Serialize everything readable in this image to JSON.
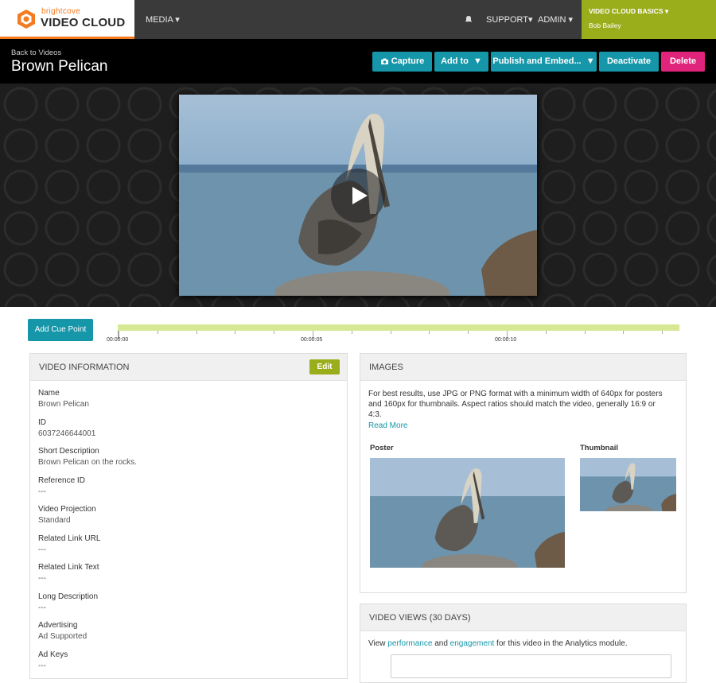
{
  "logo": {
    "small": "brightcove",
    "big": "VIDEO CLOUD"
  },
  "nav": {
    "media": "MEDIA ▾",
    "support": "SUPPORT▾",
    "admin": "ADMIN ▾"
  },
  "account": {
    "title": "VIDEO CLOUD BASICS ▾",
    "user": "Bob Bailey"
  },
  "page": {
    "back": "Back to Videos",
    "title": "Brown Pelican"
  },
  "toolbar": {
    "capture": "Capture",
    "add_to": "Add to  ▼",
    "publish": "Publish and Embed...  ▼",
    "deactivate": "Deactivate",
    "delete": "Delete"
  },
  "timeline": {
    "cue_button": "Add Cue Point",
    "labels": [
      "00:00:00",
      "00:00:05",
      "00:00:10"
    ]
  },
  "video_info": {
    "header": "VIDEO INFORMATION",
    "edit": "Edit",
    "fields": [
      {
        "label": "Name",
        "value": "Brown Pelican"
      },
      {
        "label": "ID",
        "value": "6037246644001"
      },
      {
        "label": "Short Description",
        "value": "Brown Pelican on the rocks."
      },
      {
        "label": "Reference ID",
        "value": "---"
      },
      {
        "label": "Video Projection",
        "value": "Standard"
      },
      {
        "label": "Related Link URL",
        "value": "---"
      },
      {
        "label": "Related Link Text",
        "value": "---"
      },
      {
        "label": "Long Description",
        "value": "---"
      },
      {
        "label": "Advertising",
        "value": "Ad Supported"
      },
      {
        "label": "Ad Keys",
        "value": "---"
      }
    ]
  },
  "images": {
    "header": "IMAGES",
    "hint_l1": "For best results, use JPG or PNG format with a minimum width of 640px for posters",
    "hint_l2": "and 160px for thumbnails. Aspect ratios should match the video, generally 16:9 or",
    "hint_l3": "4:3.",
    "read_more": "Read More",
    "poster": "Poster",
    "thumbnail": "Thumbnail"
  },
  "views": {
    "header": "VIDEO VIEWS (30 DAYS)",
    "pre": "View ",
    "performance": "performance",
    "mid": " and ",
    "engagement": "engagement",
    "post": " for this video in the Analytics module."
  },
  "colors": {
    "accent": "#1596a9",
    "delete": "#e0247c",
    "account": "#9aae1c",
    "brand": "#f47b20"
  }
}
